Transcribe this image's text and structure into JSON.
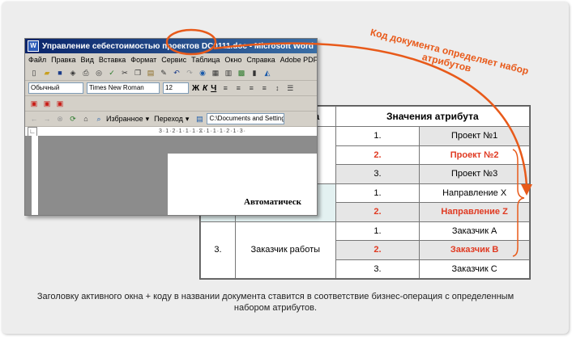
{
  "window": {
    "title": "Управление себестоимостью проектов DC0111.doc - Microsoft Word"
  },
  "menu": [
    "Файл",
    "Правка",
    "Вид",
    "Вставка",
    "Формат",
    "Сервис",
    "Таблица",
    "Окно",
    "Справка",
    "Adobe PDF"
  ],
  "formatting": {
    "style": "Обычный",
    "font": "Times New Roman",
    "size": "12",
    "bold": "Ж",
    "italic": "К",
    "underline": "Ч"
  },
  "web_toolbar": {
    "favorites": "Избранное",
    "go": "Переход",
    "address": "C:\\Documents and Settings\\serga"
  },
  "document": {
    "heading_fragment": "Автоматическ"
  },
  "table": {
    "header_col2_fragment": "ва",
    "header_values": "Значения атрибута",
    "row_number": "3.",
    "row_name": "Заказчик работы",
    "rows": [
      {
        "n": "1.",
        "v": "Проект №1",
        "highlight": false
      },
      {
        "n": "2.",
        "v": "Проект №2",
        "highlight": true
      },
      {
        "n": "3.",
        "v": "Проект №3",
        "highlight": false
      },
      {
        "n": "1.",
        "v": "Направление X",
        "highlight": false
      },
      {
        "n": "2.",
        "v": "Направление Z",
        "highlight": true
      },
      {
        "n": "1.",
        "v": "Заказчик А",
        "highlight": false
      },
      {
        "n": "2.",
        "v": "Заказчик  В",
        "highlight": true
      },
      {
        "n": "3.",
        "v": "Заказчик С",
        "highlight": false
      }
    ]
  },
  "annotation": "Код документа определяет набор атрибутов",
  "caption": "Заголовку активного окна + коду в названии документа ставится в соответствие бизнес-операция с определенным набором атрибутов.",
  "colors": {
    "accent": "#e85a1a",
    "highlight_text": "#e03a22",
    "titlebar": "#0a246a"
  }
}
